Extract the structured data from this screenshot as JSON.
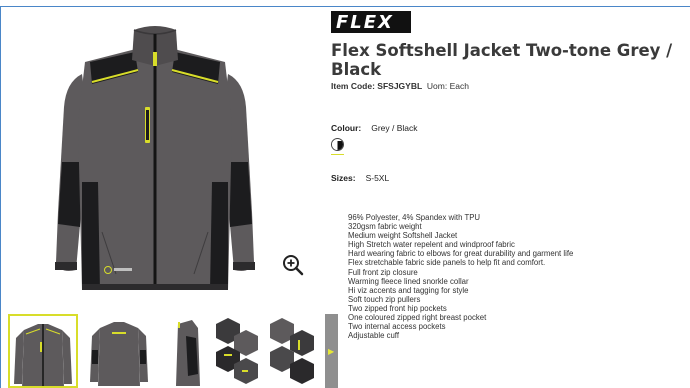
{
  "brand": {
    "logo_text": "FLEX"
  },
  "product": {
    "title": "Flex Softshell Jacket Two-tone Grey / Black",
    "item_code_label": "Item Code:",
    "item_code": "SFSJGYBL",
    "uom": "Uom: Each",
    "colour_label": "Colour:",
    "colour_value": "Grey / Black",
    "sizes_label": "Sizes:",
    "sizes_value": "S-5XL"
  },
  "colors": {
    "jacket_grey": "#5d5a5c",
    "jacket_black": "#1b1b1d",
    "accent": "#d8dd2a",
    "thumb_arrow_bg": "#8f8f8f"
  },
  "icons": {
    "zoom": "zoom-in-icon",
    "next": "chevron-right-icon"
  },
  "features": [
    "96% Polyester, 4% Spandex with TPU",
    "320gsm fabric weight",
    "Medium weight Softshell Jacket",
    "High Stretch water repelent and windproof fabric",
    "Hard wearing fabric to elbows for great durability and garment life",
    "Flex stretchable fabric side panels to help fit and comfort.",
    "Full front zip closure",
    "Warming fleece lined snorkle collar",
    "Hi viz accents and tagging for style",
    "Soft touch zip pullers",
    "Two zipped front hip pockets",
    "One coloured zipped right breast pocket",
    "Two internal access pockets",
    "Adjustable cuff"
  ]
}
